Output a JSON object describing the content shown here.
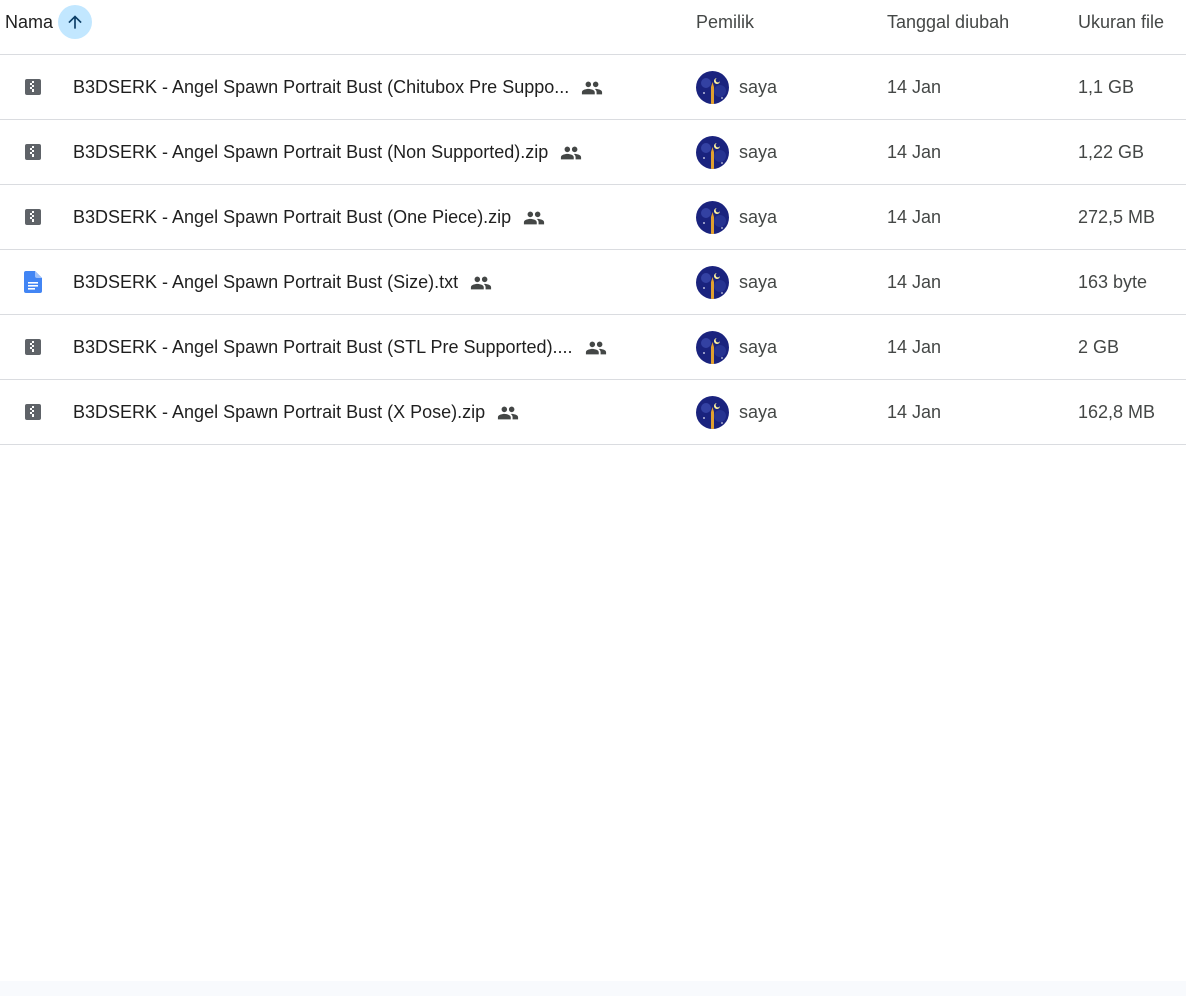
{
  "header": {
    "name_label": "Nama",
    "owner_label": "Pemilik",
    "date_label": "Tanggal diubah",
    "size_label": "Ukuran file",
    "sort_icon": "arrow-up-icon",
    "sort_active_color": "#c2e7ff"
  },
  "files": [
    {
      "name": "B3DSERK - Angel Spawn Portrait Bust (Chitubox Pre Suppo...",
      "type_icon": "zip-icon",
      "shared": true,
      "owner": "saya",
      "modified": "14 Jan",
      "size": "1,1 GB"
    },
    {
      "name": "B3DSERK - Angel Spawn Portrait Bust (Non Supported).zip",
      "type_icon": "zip-icon",
      "shared": true,
      "owner": "saya",
      "modified": "14 Jan",
      "size": "1,22 GB"
    },
    {
      "name": "B3DSERK - Angel Spawn Portrait Bust (One Piece).zip",
      "type_icon": "zip-icon",
      "shared": true,
      "owner": "saya",
      "modified": "14 Jan",
      "size": "272,5 MB"
    },
    {
      "name": "B3DSERK - Angel Spawn Portrait Bust (Size).txt",
      "type_icon": "doc-icon",
      "shared": true,
      "owner": "saya",
      "modified": "14 Jan",
      "size": "163 byte"
    },
    {
      "name": "B3DSERK - Angel Spawn Portrait Bust (STL Pre Supported)....",
      "type_icon": "zip-icon",
      "shared": true,
      "owner": "saya",
      "modified": "14 Jan",
      "size": "2 GB"
    },
    {
      "name": "B3DSERK - Angel Spawn Portrait Bust (X Pose).zip",
      "type_icon": "zip-icon",
      "shared": true,
      "owner": "saya",
      "modified": "14 Jan",
      "size": "162,8 MB"
    }
  ],
  "colors": {
    "zip_icon": "#5f6368",
    "doc_icon": "#4285f4",
    "shared_icon": "#444746",
    "divider": "#dadce0"
  }
}
